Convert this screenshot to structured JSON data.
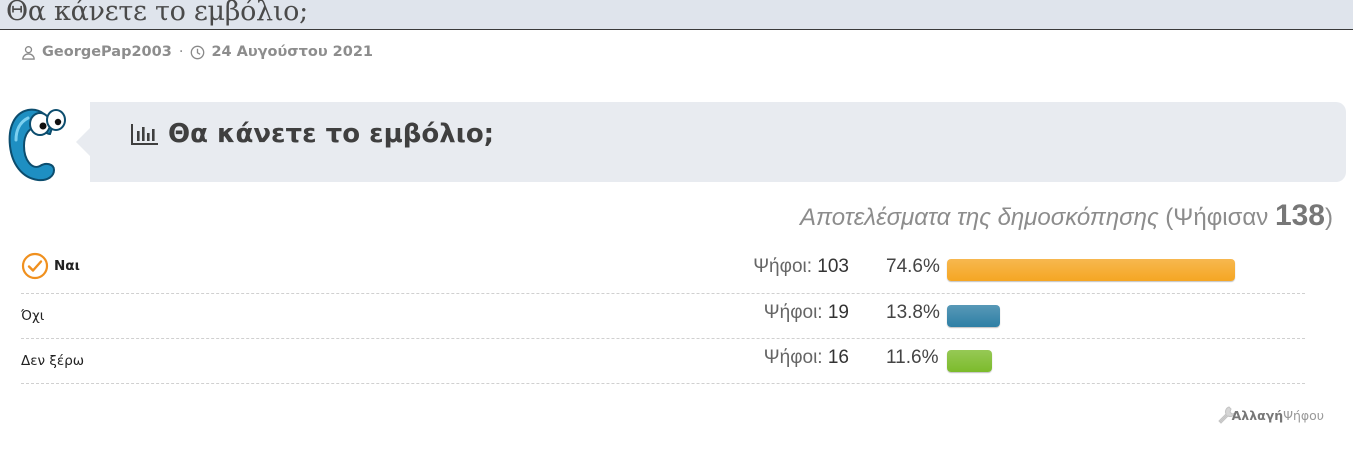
{
  "thread": {
    "title": "Θα κάνετε το εμβόλιο;",
    "author": "GeorgePap2003",
    "separator": "·",
    "date": "24 Αυγούστου 2021"
  },
  "poll": {
    "question": "Θα κάνετε το εμβόλιο;",
    "results_caption": "Αποτελέσματα της δημοσκόπησης",
    "voted_prefix": "(Ψήφισαν ",
    "voted_total": "138",
    "voted_suffix": ")",
    "votes_label": "Ψήφοι:",
    "options": [
      {
        "label": "Ναι",
        "votes": "103",
        "percent": "74.6%",
        "fraction": 0.746,
        "color": "#f5a623",
        "selected": true
      },
      {
        "label": "Όχι",
        "votes": "19",
        "percent": "13.8%",
        "fraction": 0.138,
        "color": "#2e7fa5",
        "selected": false
      },
      {
        "label": "Δεν ξέρω",
        "votes": "16",
        "percent": "11.6%",
        "fraction": 0.116,
        "color": "#7cbb2b",
        "selected": false
      }
    ],
    "change_vote_a": "Αλλαγή",
    "change_vote_b": "Ψήφου"
  }
}
